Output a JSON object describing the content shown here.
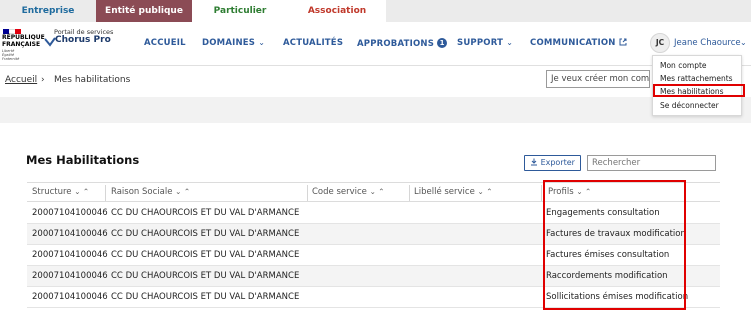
{
  "tabs": [
    {
      "label": "Entreprise"
    },
    {
      "label": "Entité publique"
    },
    {
      "label": "Particulier"
    },
    {
      "label": "Association"
    }
  ],
  "branding": {
    "rf_lines": [
      "RÉPUBLIQUE",
      "FRANÇAISE"
    ],
    "rf_motto": "Liberté Égalité Fraternité",
    "portal_label": "Portail de services",
    "product_name": "Chorus Pro",
    "flag_colors": [
      "#000091",
      "#ffffff",
      "#e1000f"
    ]
  },
  "nav": {
    "items": [
      {
        "label": "ACCUEIL"
      },
      {
        "label": "DOMAINES",
        "chevron": "⌄"
      },
      {
        "label": "ACTUALITÉS"
      },
      {
        "label": "APPROBATIONS",
        "badge": "1"
      },
      {
        "label": "SUPPORT",
        "chevron": "⌄"
      },
      {
        "label": "COMMUNICATION",
        "icon": "external-link-icon"
      }
    ]
  },
  "user": {
    "initials": "JC",
    "name": "Jeane Chaource",
    "chevron": "⌄"
  },
  "user_menu": {
    "items": [
      {
        "label": "Mon compte"
      },
      {
        "label": "Mes rattachements"
      },
      {
        "label": "Mes habilitations",
        "highlighted": true
      },
      {
        "label": "Se déconnecter"
      }
    ]
  },
  "breadcrumb": {
    "home": "Accueil",
    "separator": "›",
    "current": "Mes habilitations"
  },
  "create_account_input": {
    "value": "Je veux créer mon compte"
  },
  "page": {
    "title": "Mes Habilitations",
    "export_label": "Exporter",
    "search_placeholder": "Rechercher"
  },
  "table": {
    "sort_icons": "⌄ ⌃",
    "columns": [
      "Structure",
      "Raison Sociale",
      "Code service",
      "Libellé service",
      "Profils"
    ],
    "rows": [
      [
        "20007104100046",
        "CC DU CHAOURCOIS ET DU VAL D'ARMANCE",
        "",
        "",
        "Engagements consultation"
      ],
      [
        "20007104100046",
        "CC DU CHAOURCOIS ET DU VAL D'ARMANCE",
        "",
        "",
        "Factures de travaux modification"
      ],
      [
        "20007104100046",
        "CC DU CHAOURCOIS ET DU VAL D'ARMANCE",
        "",
        "",
        "Factures émises consultation"
      ],
      [
        "20007104100046",
        "CC DU CHAOURCOIS ET DU VAL D'ARMANCE",
        "",
        "",
        "Raccordements modification"
      ],
      [
        "20007104100046",
        "CC DU CHAOURCOIS ET DU VAL D'ARMANCE",
        "",
        "",
        "Sollicitations émises modification"
      ]
    ]
  },
  "colors": {
    "accent": "#2e5a9a",
    "public_tab": "#8b4b55",
    "highlight": "#e00000"
  }
}
